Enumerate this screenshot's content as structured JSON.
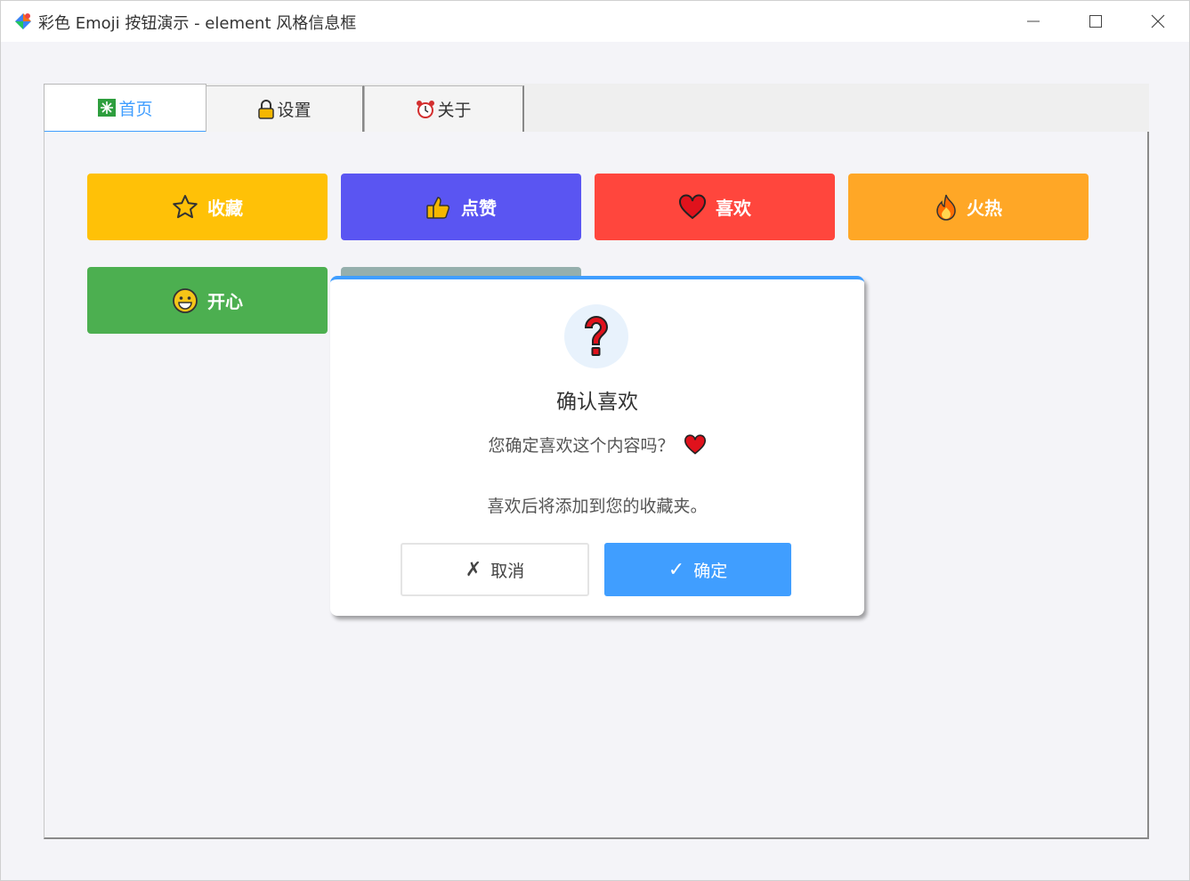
{
  "window": {
    "title": "彩色 Emoji 按钮演示 - element 风格信息框"
  },
  "tabs": [
    {
      "label": "首页",
      "icon": "sparkle-box-icon",
      "active": true
    },
    {
      "label": "设置",
      "icon": "lock-icon",
      "active": false
    },
    {
      "label": "关于",
      "icon": "alarm-clock-icon",
      "active": false
    }
  ],
  "buttons": [
    {
      "label": "收藏",
      "icon": "star-icon",
      "color": "#ffc107"
    },
    {
      "label": "点赞",
      "icon": "thumbs-up-icon",
      "color": "#5a55f2"
    },
    {
      "label": "喜欢",
      "icon": "heart-icon",
      "color": "#ff463d"
    },
    {
      "label": "火热",
      "icon": "fire-icon",
      "color": "#ffa726"
    },
    {
      "label": "开心",
      "icon": "smiley-icon",
      "color": "#4caf50"
    },
    {
      "label": "",
      "icon": "rocket-icon",
      "color": "#95afad"
    }
  ],
  "dialog": {
    "icon": "question-mark-icon",
    "title": "确认喜欢",
    "message": "您确定喜欢这个内容吗？",
    "message_icon": "heart-icon",
    "message2": "喜欢后将添加到您的收藏夹。",
    "cancel_label": "取消",
    "cancel_icon": "✗",
    "ok_label": "确定",
    "ok_icon": "✓",
    "accent_color": "#409eff"
  }
}
